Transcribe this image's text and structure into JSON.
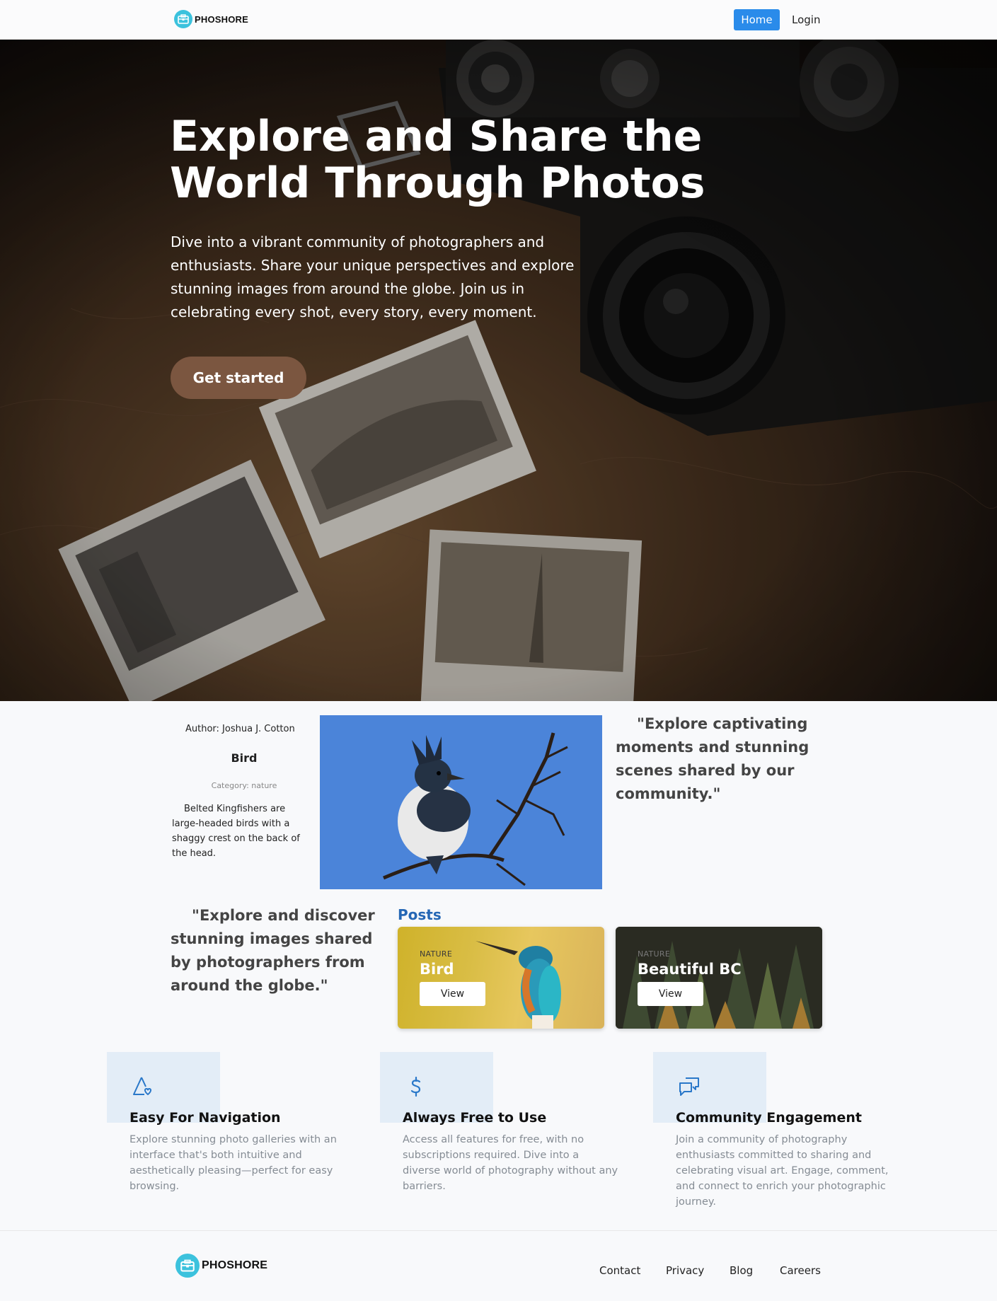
{
  "nav": {
    "brand": "PHOSHORE",
    "home": "Home",
    "login": "Login"
  },
  "hero": {
    "title": "Explore and Share the World Through Photos",
    "text": "Dive into a vibrant community of photographers and enthusiasts. Share your unique perspectives and explore stunning images from around the globe. Join us in celebrating every shot, every story, every moment.",
    "cta": "Get started"
  },
  "featured": {
    "author": "Author: Joshua J. Cotton",
    "title": "Bird",
    "category": "Category: nature",
    "description": "Belted Kingfishers are large-headed birds with a shaggy crest on the back of the head.",
    "quote": "\"Explore captivating moments and stunning scenes shared by our community.\""
  },
  "posts": {
    "quote": "\"Explore and discover stunning images shared by photographers from around the globe.\"",
    "heading": "Posts",
    "cards": [
      {
        "tag": "NATURE",
        "title": "Bird",
        "button": "View"
      },
      {
        "tag": "NATURE",
        "title": "Beautiful BC",
        "button": "View"
      }
    ]
  },
  "features": [
    {
      "icon": "map-heart-icon",
      "title": "Easy For Navigation",
      "text": "Explore stunning photo galleries with an interface that's both intuitive and aesthetically pleasing—perfect for easy browsing."
    },
    {
      "icon": "dollar-icon",
      "title": "Always Free to Use",
      "text": "Access all features for free, with no subscriptions required. Dive into a diverse world of photography without any barriers."
    },
    {
      "icon": "chat-icon",
      "title": "Community Engagement",
      "text": "Join a community of photography enthusiasts committed to sharing and celebrating visual art. Engage, comment, and connect to enrich your photographic journey."
    }
  ],
  "footer": {
    "brand": "PHOSHORE",
    "links": [
      "Contact",
      "Privacy",
      "Blog",
      "Careers"
    ]
  },
  "colors": {
    "accent_blue": "#2a8bea",
    "cta_brown": "#7b5640",
    "posts_heading": "#2567b5",
    "logo": "#3cc2dd"
  }
}
